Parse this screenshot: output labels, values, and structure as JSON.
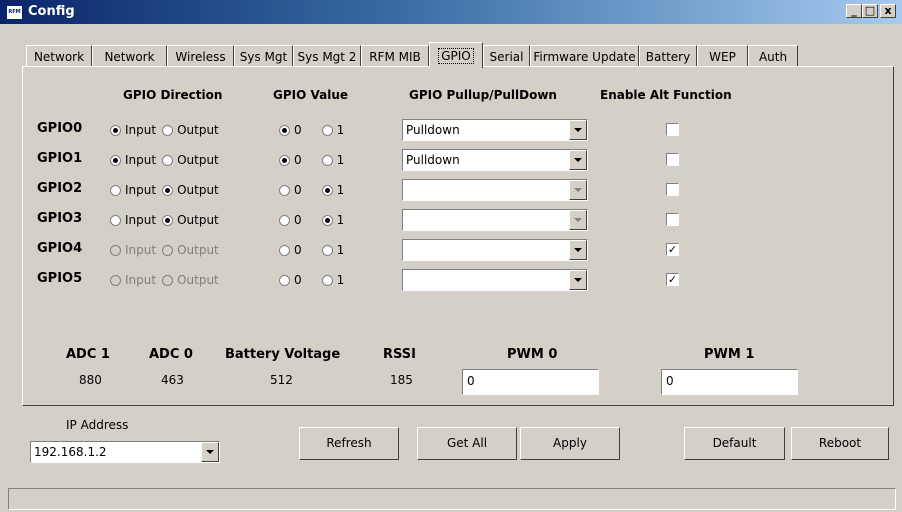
{
  "window": {
    "title": "Config",
    "icon_text": "RFM",
    "min": "_",
    "max": "□",
    "close": "x"
  },
  "tabs": [
    "Network",
    "Network",
    "Wireless",
    "Sys Mgt",
    "Sys Mgt 2",
    "RFM MIB",
    "GPIO",
    "Serial",
    "Firmware Update",
    "Battery",
    "WEP",
    "Auth"
  ],
  "active_tab": "GPIO",
  "headers": {
    "direction": "GPIO Direction",
    "value": "GPIO Value",
    "pull": "GPIO Pullup/PullDown",
    "alt": "Enable Alt Function"
  },
  "radio_labels": {
    "input": "Input",
    "output": "Output",
    "zero": "0",
    "one": "1"
  },
  "gpio": [
    {
      "name": "GPIO0",
      "direction": "Input",
      "value": "0",
      "pull": "Pulldown",
      "alt": false,
      "enabled": true
    },
    {
      "name": "GPIO1",
      "direction": "Input",
      "value": "0",
      "pull": "Pulldown",
      "alt": false,
      "enabled": true
    },
    {
      "name": "GPIO2",
      "direction": "Output",
      "value": "1",
      "pull": "",
      "alt": false,
      "enabled": true
    },
    {
      "name": "GPIO3",
      "direction": "Output",
      "value": "1",
      "pull": "",
      "alt": false,
      "enabled": true
    },
    {
      "name": "GPIO4",
      "direction": "",
      "value": "",
      "pull": "",
      "alt": true,
      "enabled": false
    },
    {
      "name": "GPIO5",
      "direction": "",
      "value": "",
      "pull": "",
      "alt": true,
      "enabled": false
    }
  ],
  "analog": {
    "adc1": {
      "label": "ADC 1",
      "value": "880"
    },
    "adc0": {
      "label": "ADC 0",
      "value": "463"
    },
    "battery": {
      "label": "Battery Voltage",
      "value": "512"
    },
    "rssi": {
      "label": "RSSI",
      "value": "185"
    },
    "pwm0": {
      "label": "PWM 0",
      "value": "0"
    },
    "pwm1": {
      "label": "PWM 1",
      "value": "0"
    }
  },
  "ip": {
    "label": "IP Address",
    "value": "192.168.1.2"
  },
  "buttons": {
    "refresh": "Refresh",
    "get_all": "Get All",
    "apply": "Apply",
    "default": "Default",
    "reboot": "Reboot"
  }
}
